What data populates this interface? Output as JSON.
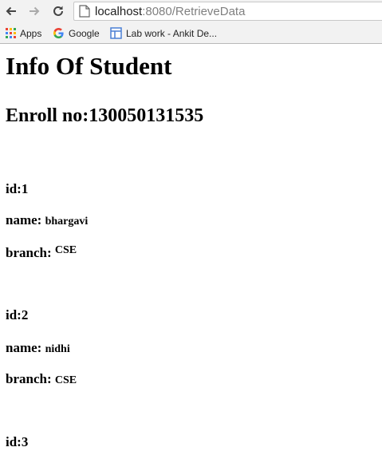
{
  "browser": {
    "url_host": "localhost",
    "url_path": ":8080/RetrieveData"
  },
  "bookmarks": [
    {
      "label": "Apps",
      "icon": "apps-grid-icon"
    },
    {
      "label": "Google",
      "icon": "google-g-icon"
    },
    {
      "label": "Lab work - Ankit De...",
      "icon": "page-layout-icon"
    }
  ],
  "page": {
    "title": "Info Of Student",
    "enroll": "Enroll no:130050131535"
  },
  "students": [
    {
      "id_label": "id:1",
      "name_label": "name:",
      "name": "bhargavi",
      "branch_label": "branch:",
      "branch": "CSE"
    },
    {
      "id_label": "id:2",
      "name_label": "name:",
      "name": "nidhi",
      "branch_label": "branch:",
      "branch": "CSE"
    },
    {
      "id_label": "id:3"
    }
  ]
}
